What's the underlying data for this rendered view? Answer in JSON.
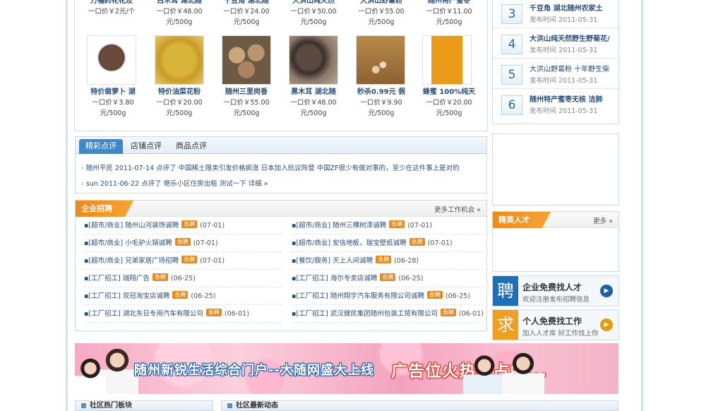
{
  "products_top": [
    {
      "name": "万福药花花及",
      "price": "一口价￥2元/个"
    },
    {
      "name": "白木耳 湖北随",
      "price": "一口价￥48.00",
      "unit": "元/500g"
    },
    {
      "name": "千豆角 湖北随",
      "price": "一口价￥24.00",
      "unit": "元/500g"
    },
    {
      "name": "大洪山纯天然",
      "price": "一口价￥50.00",
      "unit": "元/500g"
    },
    {
      "name": "大洪山野葛粉",
      "price": "一口价￥55.00",
      "unit": "元/500g"
    },
    {
      "name": "随州特产蜜枣",
      "price": "一口价￥11.00",
      "unit": "元/500g"
    }
  ],
  "products": [
    {
      "name": "特价凿萝卜 湖",
      "price": "一口价￥3.80",
      "unit": "元/500g"
    },
    {
      "name": "特价油菜花粉",
      "price": "一口价￥20.00",
      "unit": "元/500g"
    },
    {
      "name": "随州三里岗香",
      "price": "一口价￥55.00",
      "unit": "元/500g"
    },
    {
      "name": "黑木耳 湖北随",
      "price": "一口价￥48.00",
      "unit": "元/500g"
    },
    {
      "name": "秒杀0.99元 假",
      "price": "一口价￥9.90",
      "unit": "元/500g"
    },
    {
      "name": "蜂蜜 100%纯天",
      "price": "一口价￥20.00",
      "unit": "元/500g"
    }
  ],
  "reviews": {
    "tabs": [
      "精彩点评",
      "店铺点评",
      "商品点评"
    ],
    "items": [
      "随州平民 2011-07-14 点评了 中国稀土限卖引发价格疯涨 日本加入抗议阵营  中国ZF很少有做对事的，至少在这件事上是对的",
      "sun 2011-06-22 点评了 艳乐小区住房出租  测试一下 详细 »"
    ]
  },
  "jobs": {
    "title": "企业招聘",
    "more": "更多工作机会 »",
    "badge": "急聘",
    "left": [
      {
        "text": "[超市/商业] 随州山河装饰诚聘",
        "date": "(07-01)"
      },
      {
        "text": "[超市/商业] 小毛驴火锅诚聘",
        "date": "(07-01)"
      },
      {
        "text": "[超市/商业] 兄弟家居广场招聘",
        "date": "(07-01)"
      },
      {
        "text": "[工厂招工] 瑞翔广告",
        "date": "(06-25)"
      },
      {
        "text": "[工厂招工] 双冠淘宝店诚聘",
        "date": "(06-25)"
      },
      {
        "text": "[工厂招工] 湖北东日专用汽车有限公司",
        "date": "(06-01)"
      }
    ],
    "right": [
      {
        "text": "[超市/商业] 随州三棵树漆诚聘",
        "date": "(07-01)"
      },
      {
        "text": "[超市/商业] 安信地板，瑞宝壁纸诚聘",
        "date": "(07-01)"
      },
      {
        "text": "[餐饮/服务] 天上人间诚聘",
        "date": "(06-28)"
      },
      {
        "text": "[工厂招工] 海尔专卖店诚聘",
        "date": "(06-25)"
      },
      {
        "text": "[工厂招工] 随州翔宇汽车服务有限公司诚聘",
        "date": "(06-25)"
      },
      {
        "text": "[工厂招工] 武汉健民集团随州包装工贸有限公司",
        "date": "(06-01)"
      }
    ]
  },
  "ranking": [
    {
      "num": "3",
      "title": "千豆角 湖北随州农家土",
      "label": "发布时间",
      "date": "2011-05-31",
      "bold": true
    },
    {
      "num": "4",
      "title": "大洪山纯天然野生野菊花/",
      "label": "发布时间",
      "date": "2011-05-31",
      "bold": true
    },
    {
      "num": "5",
      "title": "大洪山野葛粉 十年野生柴",
      "label": "发布时间",
      "date": "2011-05-31",
      "bold": false
    },
    {
      "num": "6",
      "title": "随州特产蜜枣无核 洁肺",
      "label": "发布时间",
      "date": "2011-05-31",
      "bold": true
    }
  ],
  "talent": {
    "title": "精英人才",
    "more": "更多 »"
  },
  "promos": [
    {
      "icon": "聘",
      "title": "企业免费找人才",
      "sub": "欢迎注册发布招聘信息",
      "color": "#1e6fb8"
    },
    {
      "icon": "求",
      "title": "个人免费找工作",
      "sub": "加入人才库 好工作找上你",
      "color": "#f0a020"
    }
  ],
  "banner": {
    "left": "随州新锐生活综合门户--大随网盛大上线",
    "right": "广告位火热抢占中..."
  },
  "sections": {
    "hot": "社区热门板块",
    "news": "社区最新动态"
  }
}
